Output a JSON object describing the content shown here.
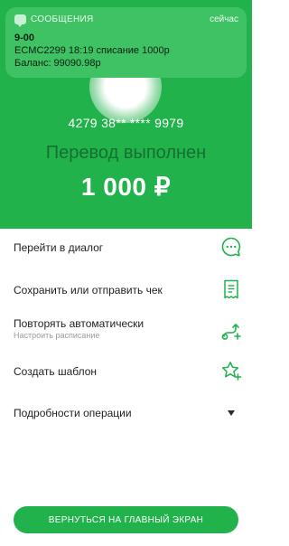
{
  "notification": {
    "app_name": "СООБЩЕНИЯ",
    "time": "сейчас",
    "sender": "9-00",
    "line1": "ECMC2299 18:19 списание 1000р",
    "line2": "Баланс: 99090.98р"
  },
  "transfer": {
    "card_number": "4279 38** **** 9979",
    "status": "Перевод выполнен",
    "amount": "1 000 ₽"
  },
  "actions": {
    "dialog": "Перейти в диалог",
    "receipt": "Сохранить или отправить чек",
    "repeat": "Повторять автоматически",
    "repeat_sub": "Настроить расписание",
    "template": "Создать шаблон",
    "details": "Подробности операции"
  },
  "cta": {
    "label": "ВЕРНУТЬСЯ НА ГЛАВНЫЙ ЭКРАН"
  },
  "colors": {
    "brand_green": "#22b24c",
    "notification_bg": "#3ec264"
  },
  "icons": {
    "dialog": "chat-bubble-icon",
    "receipt": "receipt-icon",
    "repeat": "repeat-schedule-icon",
    "template": "star-plus-icon",
    "details": "chevron-down-icon"
  }
}
